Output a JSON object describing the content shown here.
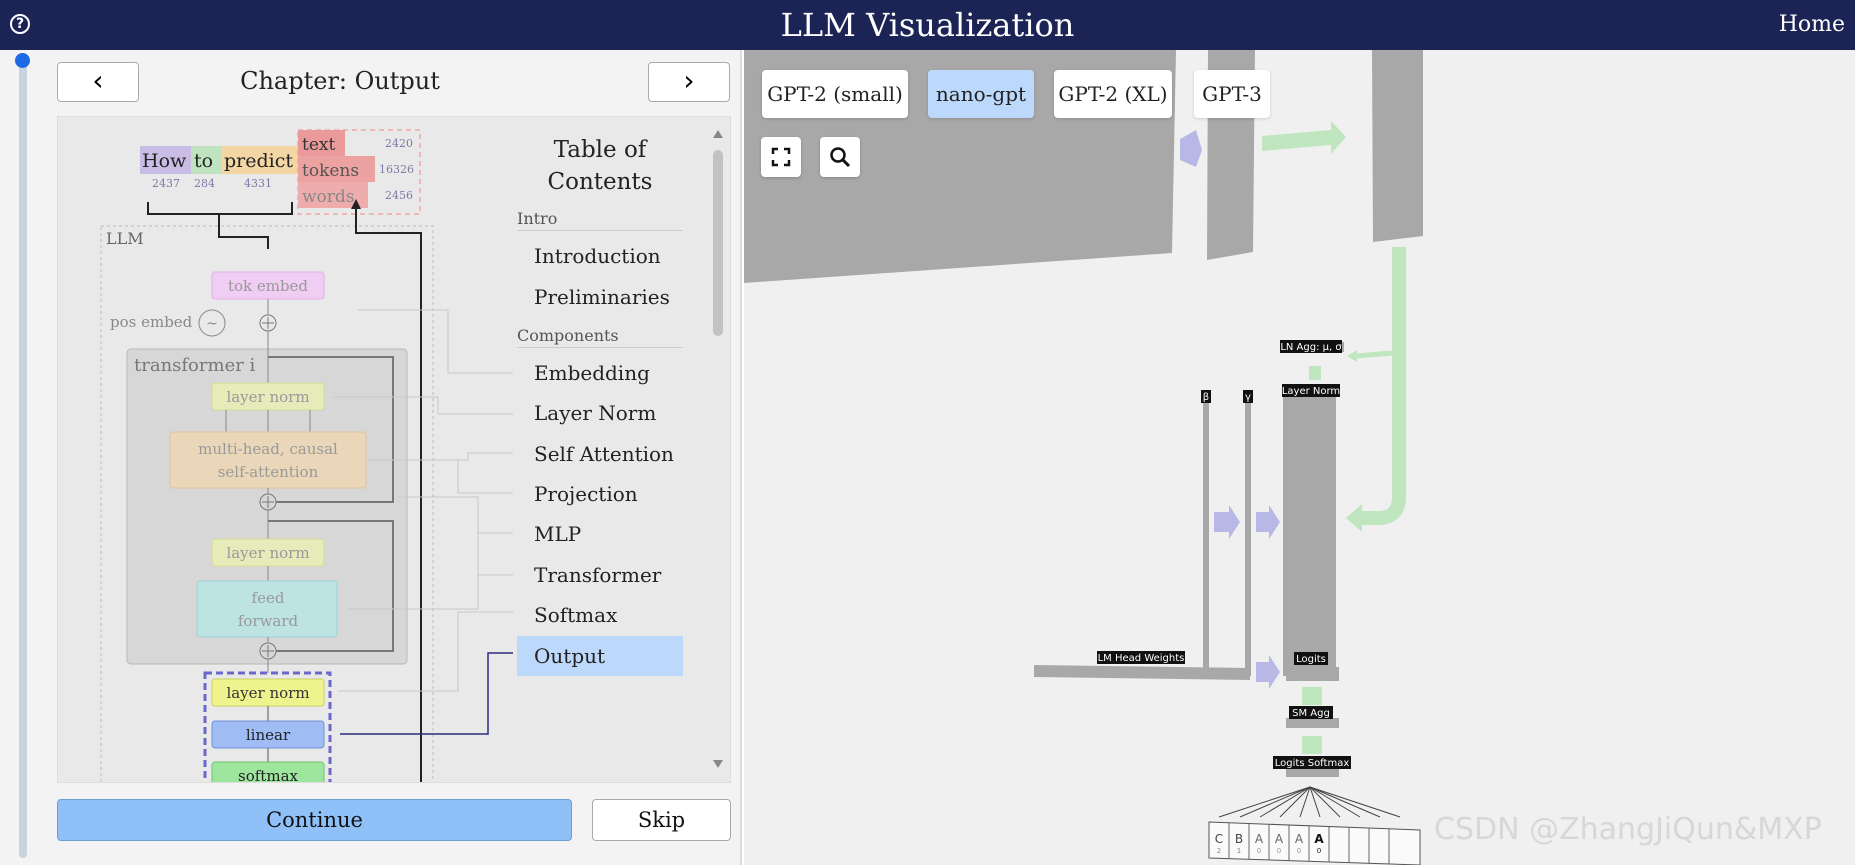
{
  "header": {
    "title": "LLM Visualization",
    "home": "Home"
  },
  "nav": {
    "prev": "‹",
    "next": "›",
    "chapter": "Chapter: Output"
  },
  "diagram": {
    "tokens": [
      {
        "text": "How",
        "id": "2437"
      },
      {
        "text": "to",
        "id": "284"
      },
      {
        "text": "predict",
        "id": "4331"
      }
    ],
    "predictions": [
      {
        "text": "text",
        "id": "2420"
      },
      {
        "text": "tokens",
        "id": "16326"
      },
      {
        "text": "words",
        "id": "2456"
      }
    ],
    "llm": "LLM",
    "tok_embed": "tok embed",
    "pos_embed": "pos embed",
    "transformer": "transformer i",
    "layer_norm": "layer norm",
    "attention_l1": "multi-head, causal",
    "attention_l2": "self-attention",
    "ff_l1": "feed",
    "ff_l2": "forward",
    "layer_norm_final": "layer norm",
    "linear": "linear",
    "softmax": "softmax"
  },
  "toc": {
    "title_l1": "Table of",
    "title_l2": "Contents",
    "section_intro": "Intro",
    "section_components": "Components",
    "items": [
      "Introduction",
      "Preliminaries",
      "Embedding",
      "Layer Norm",
      "Self Attention",
      "Projection",
      "MLP",
      "Transformer",
      "Softmax",
      "Output"
    ],
    "active": "Output"
  },
  "buttons": {
    "continue": "Continue",
    "skip": "Skip"
  },
  "models": [
    "GPT-2 (small)",
    "nano-gpt",
    "GPT-2 (XL)",
    "GPT-3"
  ],
  "active_model": "nano-gpt",
  "viz_labels": {
    "ln_agg": "LN Agg: μ, σ",
    "layer_norm": "Layer Norm",
    "beta": "β",
    "gamma": "γ",
    "lm_head": "LM Head Weights",
    "logits": "Logits",
    "sm_agg": "SM Agg",
    "logits_softmax": "Logits Softmax"
  },
  "output_cells": [
    {
      "letter": "C",
      "num": "2"
    },
    {
      "letter": "B",
      "num": "1"
    },
    {
      "letter": "A",
      "num": "0"
    },
    {
      "letter": "A",
      "num": "0"
    },
    {
      "letter": "A",
      "num": "0"
    },
    {
      "letter": "A",
      "num": "0"
    }
  ],
  "watermark": "CSDN @ZhangJiQun&MXP",
  "icons": [
    "help-icon",
    "chevron-left-icon",
    "chevron-right-icon",
    "fullscreen-icon",
    "search-icon"
  ],
  "colors": {
    "header": "#1c2456",
    "active": "#bcd8fb",
    "continue": "#8fc0f7"
  }
}
